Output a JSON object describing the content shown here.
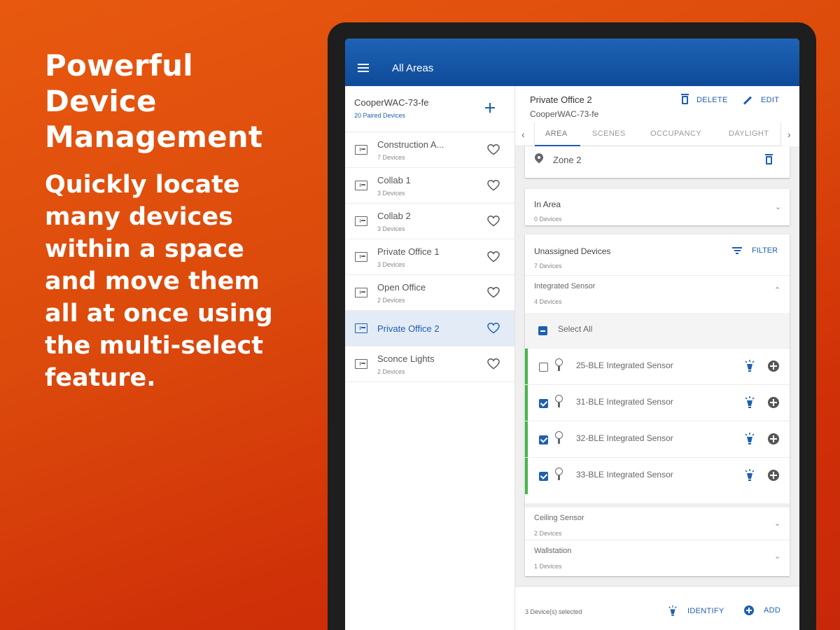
{
  "promo": {
    "title_lines": [
      "Powerful",
      "Device",
      "Management"
    ],
    "body_lines": [
      "Quickly locate",
      "many devices",
      "within a space",
      "and move them",
      "all at once using",
      "the multi-select",
      "feature."
    ]
  },
  "appbar": {
    "title": "All Areas"
  },
  "left": {
    "controller_name": "CooperWAC-73-fe",
    "controller_sub": "20 Paired Devices",
    "areas": [
      {
        "name": "Construction A...",
        "count": "7 Devices"
      },
      {
        "name": "Collab 1",
        "count": "3 Devices"
      },
      {
        "name": "Collab 2",
        "count": "3 Devices"
      },
      {
        "name": "Private Office 1",
        "count": "3 Devices"
      },
      {
        "name": "Open Office",
        "count": "2 Devices"
      },
      {
        "name": "Private Office 2",
        "count": ""
      },
      {
        "name": "Sconce Lights",
        "count": "2 Devices"
      }
    ]
  },
  "detail": {
    "title": "Private Office 2",
    "subtitle": "CooperWAC-73-fe",
    "delete_label": "DELETE",
    "edit_label": "EDIT",
    "tabs": [
      "AREA",
      "SCENES",
      "OCCUPANCY",
      "DAYLIGHT"
    ],
    "zone": "Zone 2",
    "in_area": {
      "title": "In Area",
      "count": "0 Devices"
    },
    "unassigned": {
      "title": "Unassigned Devices",
      "count": "7 Devices",
      "filter_label": "FILTER"
    },
    "integrated": {
      "title": "Integrated Sensor",
      "count": "4 Devices"
    },
    "select_all": "Select All",
    "devices": [
      {
        "name": "25-BLE Integrated Sensor",
        "checked": false
      },
      {
        "name": "31-BLE Integrated Sensor",
        "checked": true
      },
      {
        "name": "32-BLE Integrated Sensor",
        "checked": true
      },
      {
        "name": "33-BLE Integrated Sensor",
        "checked": true
      }
    ],
    "ceiling": {
      "title": "Ceiling Sensor",
      "count": "2 Devices"
    },
    "wallstation": {
      "title": "Wallstation",
      "count": "1 Devices"
    }
  },
  "footer": {
    "selected": "3 Device(s) selected",
    "identify_label": "IDENTIFY",
    "add_label": "ADD"
  },
  "colors": {
    "accent": "#1f5fb0",
    "stripe": "#43b649",
    "appbar": "#0f4a99"
  }
}
